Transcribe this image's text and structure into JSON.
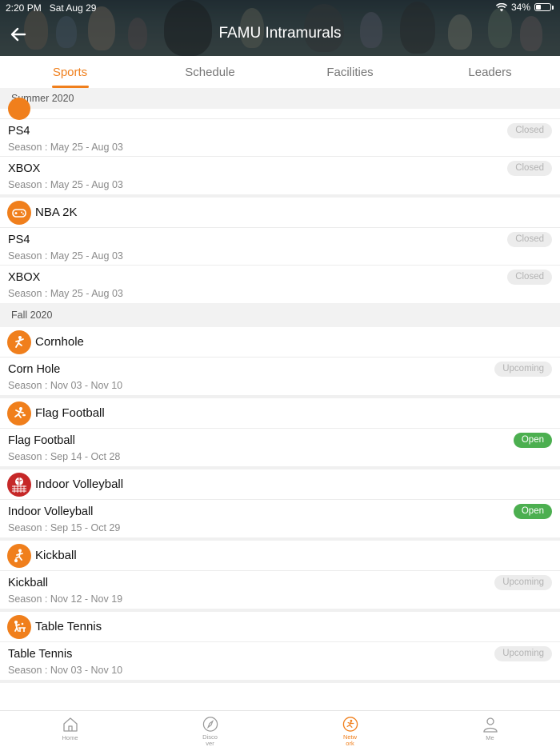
{
  "status": {
    "time": "2:20 PM",
    "date": "Sat Aug 29",
    "battery": "34%"
  },
  "header": {
    "title": "FAMU Intramurals"
  },
  "tabs": [
    {
      "label": "Sports",
      "active": true
    },
    {
      "label": "Schedule",
      "active": false
    },
    {
      "label": "Facilities",
      "active": false
    },
    {
      "label": "Leaders",
      "active": false
    }
  ],
  "sections": {
    "summer": "Summer 2020",
    "fall": "Fall 2020"
  },
  "summer_partial": [
    {
      "title": "PS4",
      "season": "Season : May 25 - Aug 03",
      "status": "Closed"
    },
    {
      "title": "XBOX",
      "season": "Season : May 25 - Aug 03",
      "status": "Closed"
    }
  ],
  "nba": {
    "name": "NBA 2K",
    "rows": [
      {
        "title": "PS4",
        "season": "Season : May 25 - Aug 03",
        "status": "Closed"
      },
      {
        "title": "XBOX",
        "season": "Season : May 25 - Aug 03",
        "status": "Closed"
      }
    ]
  },
  "fall": [
    {
      "name": "Cornhole",
      "row": {
        "title": "Corn Hole",
        "season": "Season : Nov 03 - Nov 10",
        "status": "Upcoming"
      }
    },
    {
      "name": "Flag Football",
      "row": {
        "title": "Flag Football",
        "season": "Season : Sep 14 - Oct 28",
        "status": "Open"
      }
    },
    {
      "name": "Indoor Volleyball",
      "row": {
        "title": "Indoor Volleyball",
        "season": "Season : Sep 15 - Oct 29",
        "status": "Open"
      }
    },
    {
      "name": "Kickball",
      "row": {
        "title": "Kickball",
        "season": "Season : Nov 12 - Nov 19",
        "status": "Upcoming"
      }
    },
    {
      "name": "Table Tennis",
      "row": {
        "title": "Table Tennis",
        "season": "Season : Nov 03 - Nov 10",
        "status": "Upcoming"
      }
    }
  ],
  "nav": [
    {
      "label": "Home",
      "icon": "home-icon"
    },
    {
      "label": "Discover",
      "icon": "compass-icon"
    },
    {
      "label": "Network",
      "icon": "network-icon",
      "active": true
    },
    {
      "label": "Me",
      "icon": "person-icon"
    }
  ],
  "colors": {
    "accent": "#f07f1c",
    "open": "#4caf50"
  }
}
